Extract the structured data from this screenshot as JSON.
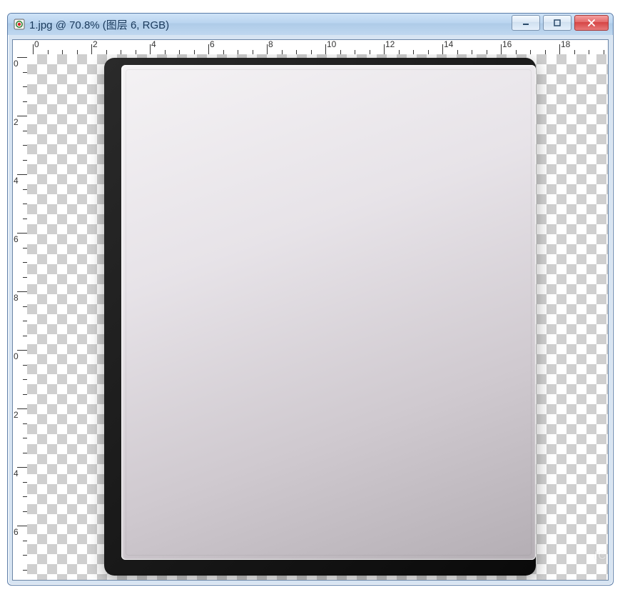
{
  "window": {
    "title": "1.jpg @ 70.8% (图层 6, RGB)"
  },
  "rulers": {
    "horizontal_labels": [
      "0",
      "2",
      "4",
      "6",
      "8",
      "10",
      "12",
      "14",
      "16",
      "18"
    ],
    "vertical_labels": [
      "0",
      "2",
      "4",
      "6",
      "8",
      "0",
      "2",
      "4",
      "6"
    ]
  },
  "canvas": {
    "watermark": "IC"
  }
}
